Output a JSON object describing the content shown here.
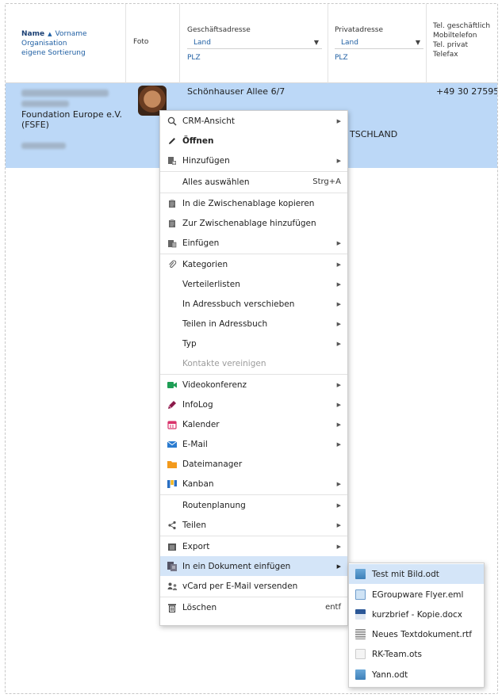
{
  "header": {
    "name": "Name",
    "vorname": "Vorname",
    "organisation": "Organisation",
    "sortierung": "eigene Sortierung",
    "foto": "Foto",
    "geschaeftsadresse": "Geschäftsadresse",
    "land": "Land",
    "plz": "PLZ",
    "privatadresse": "Privatadresse",
    "land2": "Land",
    "plz2": "PLZ",
    "tel_geschaeftlich": "Tel. geschäftlich",
    "mobiltelefon": "Mobiltelefon",
    "tel_privat": "Tel. privat",
    "telefax": "Telefax"
  },
  "row": {
    "org_line1": "Foundation Europe e.V.",
    "org_line2": "(FSFE)",
    "street": "Schönhauser Allee 6/7",
    "country_partial": "TSCHLAND",
    "phone": "+49 30 27595"
  },
  "menu": {
    "items": [
      {
        "label": "CRM-Ansicht",
        "icon": "search-icon"
      },
      {
        "label": "Öffnen",
        "icon": "pencil-icon"
      },
      {
        "label": "Hinzufügen",
        "icon": "add-document-icon"
      },
      {
        "label": "Alles auswählen",
        "shortcut": "Strg+A"
      },
      {
        "label": "In die Zwischenablage kopieren",
        "icon": "clipboard-icon"
      },
      {
        "label": "Zur Zwischenablage hinzufügen",
        "icon": "clipboard-add-icon"
      },
      {
        "label": "Einfügen",
        "icon": "paste-icon"
      },
      {
        "label": "Kategorien",
        "icon": "paperclip-icon"
      },
      {
        "label": "Verteilerlisten"
      },
      {
        "label": "In Adressbuch verschieben"
      },
      {
        "label": "Teilen in Adressbuch"
      },
      {
        "label": "Typ"
      },
      {
        "label": "Kontakte vereinigen"
      },
      {
        "label": "Videokonferenz",
        "icon": "video-icon"
      },
      {
        "label": "InfoLog",
        "icon": "infolog-icon"
      },
      {
        "label": "Kalender",
        "icon": "calendar-icon"
      },
      {
        "label": "E-Mail",
        "icon": "mail-icon"
      },
      {
        "label": "Dateimanager",
        "icon": "folder-icon"
      },
      {
        "label": "Kanban",
        "icon": "kanban-icon"
      },
      {
        "label": "Routenplanung"
      },
      {
        "label": "Teilen",
        "icon": "share-icon"
      },
      {
        "label": "Export",
        "icon": "export-icon"
      },
      {
        "label": "In ein Dokument einfügen",
        "icon": "merge-document-icon"
      },
      {
        "label": "vCard per E-Mail versenden",
        "icon": "vcard-icon"
      },
      {
        "label": "Löschen",
        "icon": "trash-icon",
        "shortcut": "entf"
      }
    ]
  },
  "submenu": {
    "items": [
      {
        "label": "Test mit Bild.odt",
        "icon": "odt-file-icon"
      },
      {
        "label": "EGroupware Flyer.eml",
        "icon": "eml-file-icon"
      },
      {
        "label": "kurzbrief - Kopie.docx",
        "icon": "docx-file-icon"
      },
      {
        "label": "Neues Textdokument.rtf",
        "icon": "rtf-file-icon"
      },
      {
        "label": "RK-Team.ots",
        "icon": "ots-file-icon"
      },
      {
        "label": "Yann.odt",
        "icon": "odt-file-icon"
      }
    ]
  },
  "colors": {
    "selected_row": "#bcd8f7",
    "menu_hover": "#d4e5f8",
    "link": "#1f5fa3"
  }
}
